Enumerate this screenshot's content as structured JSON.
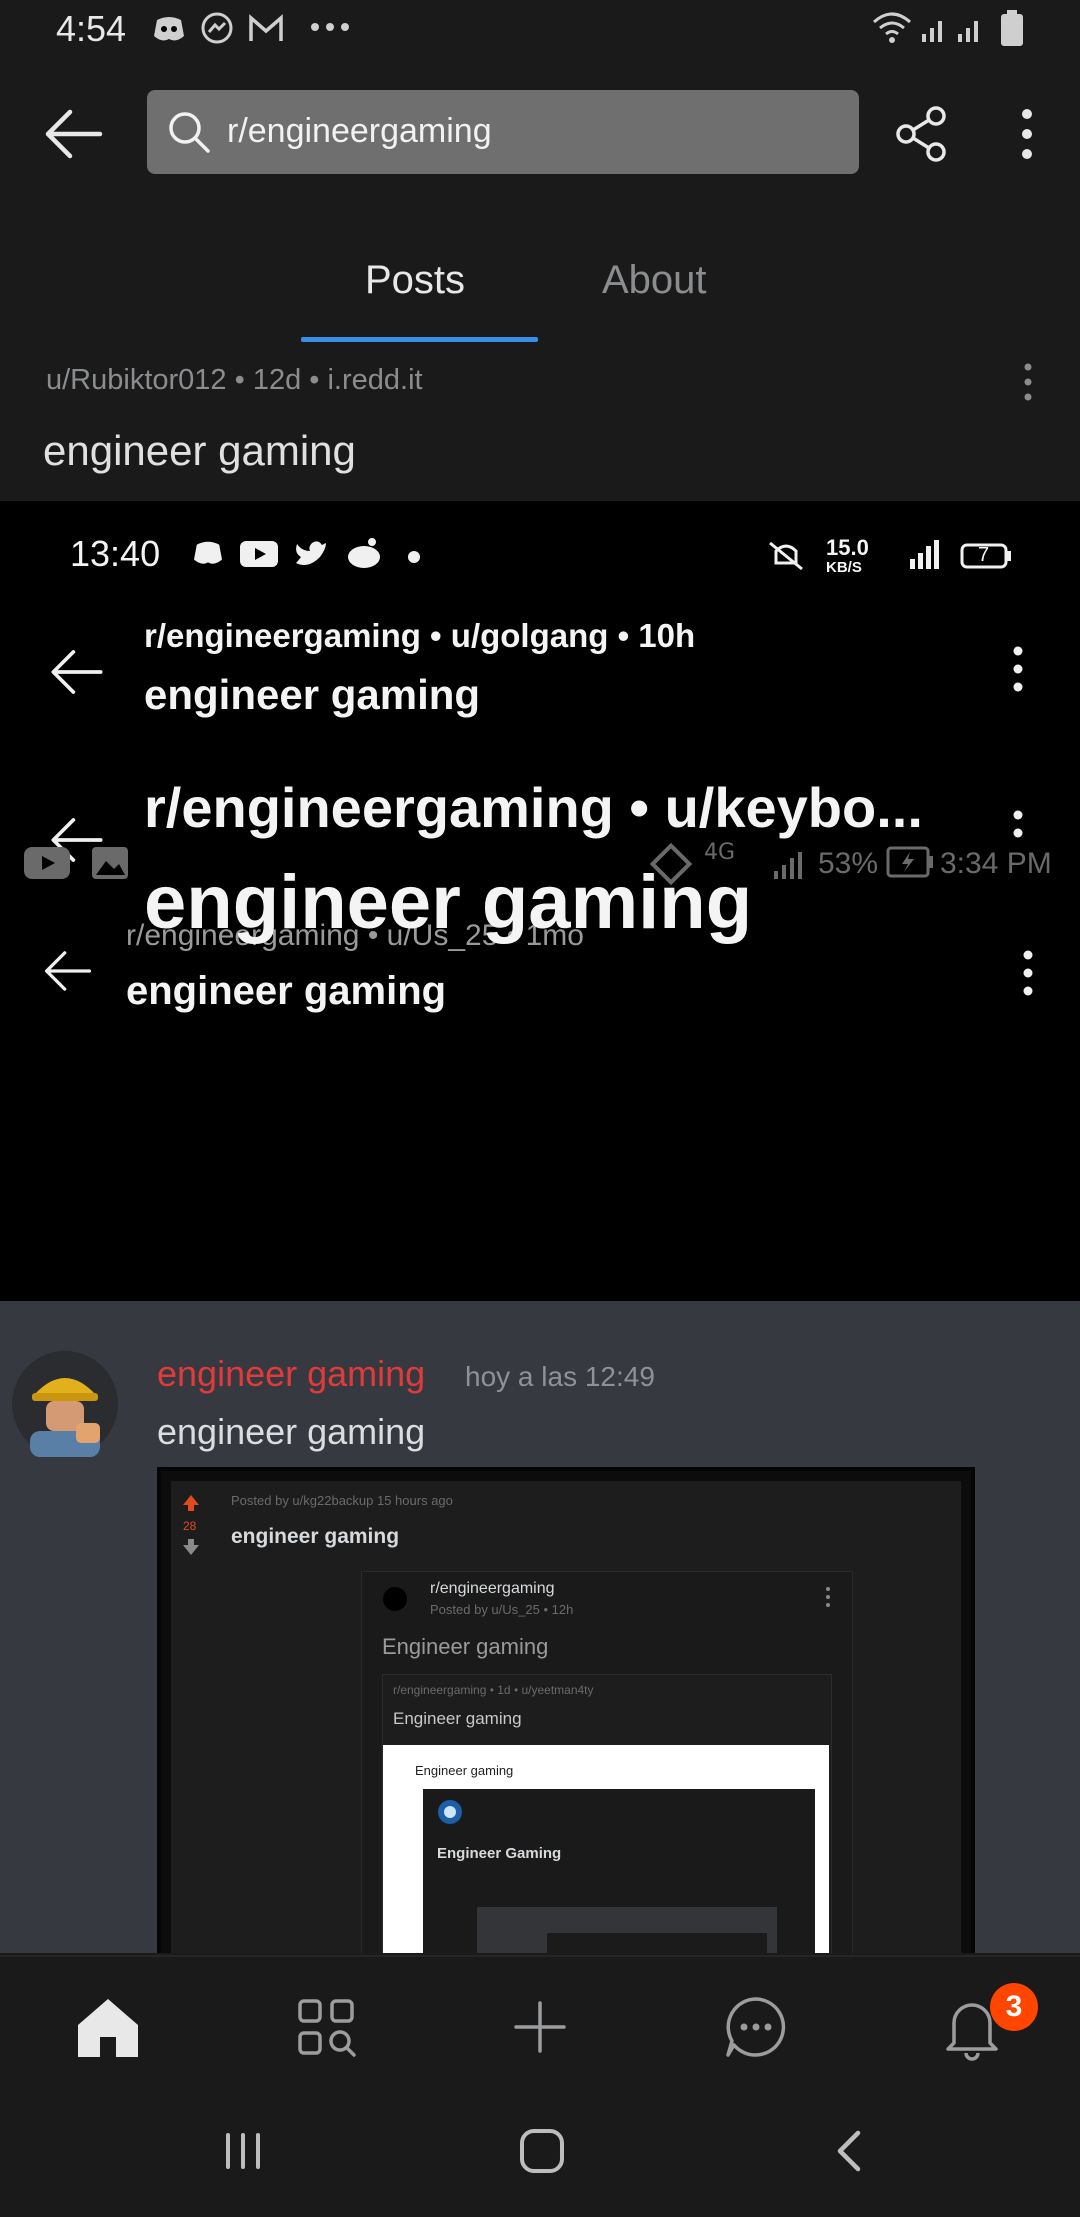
{
  "status_bar": {
    "time": "4:54"
  },
  "search": {
    "query": "r/engineergaming"
  },
  "tabs": [
    {
      "label": "Posts"
    },
    {
      "label": "About"
    }
  ],
  "post": {
    "meta": "u/Rubiktor012 • 12d • i.redd.it",
    "title": "engineer gaming"
  },
  "image": {
    "inner_status": {
      "time": "13:40",
      "speed": "15.0",
      "speed_unit": "KB/S",
      "battery": "7"
    },
    "row1": {
      "meta": "r/engineergaming • u/golgang • 10h",
      "title": "engineer gaming"
    },
    "row2": {
      "meta": "r/engineergaming • u/keybo...",
      "title": "engineer gaming",
      "status_battery": "53%",
      "status_time": "3:34 PM"
    },
    "row3": {
      "meta": "r/engineergaming • u/Us_25 • 1mo",
      "title": "engineer gaming"
    },
    "discord": {
      "username": "engineer gaming",
      "timestamp": "hoy a las 12:49",
      "message": "engineer gaming",
      "embed": {
        "posted_by": "Posted by u/kg22backup 15 hours ago",
        "votes": "28",
        "title": "engineer gaming",
        "nested_sub": "r/engineergaming",
        "nested_by": "Posted by u/Us_25 • 12h",
        "nested_title": "Engineer gaming",
        "nested2_meta": "r/engineergaming • 1d • u/yeetman4ty",
        "nested2_title": "Engineer gaming",
        "nested3_title": "Engineer gaming",
        "nested4_title": "Engineer Gaming"
      }
    }
  },
  "notifications": {
    "count": "3"
  }
}
